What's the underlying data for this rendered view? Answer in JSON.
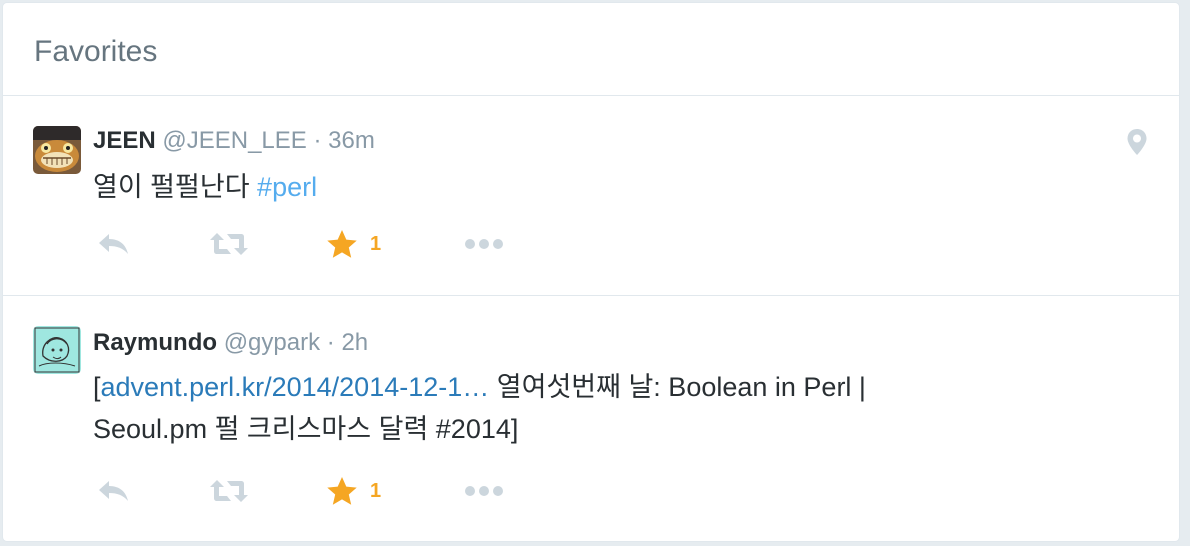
{
  "panel": {
    "title": "Favorites"
  },
  "tweets": [
    {
      "fullname": "JEEN",
      "screenname": "@JEEN_LEE",
      "separator": "·",
      "time": "36m",
      "text_main": "열이 펄펄난다 ",
      "hashtag": "#perl",
      "fav_count": "1",
      "icons": [
        "reply-icon",
        "retweet-icon",
        "favorite-icon",
        "more-icon",
        "geo-pin-icon"
      ]
    },
    {
      "fullname": "Raymundo",
      "screenname": "@gypark",
      "separator": "·",
      "time": "2h",
      "text_open": "[",
      "link": "advent.perl.kr/2014/2014-12-1…",
      "text_rest": " 열여섯번째 날: Boolean in Perl |",
      "text_line2": "Seoul.pm 펄 크리스마스 달력 #2014]",
      "fav_count": "1",
      "icons": [
        "reply-icon",
        "retweet-icon",
        "favorite-icon",
        "more-icon"
      ]
    }
  ],
  "colors": {
    "favorite": "#f5a623",
    "link": "#2b7bb9",
    "hashtag": "#55acee",
    "muted": "#8899a6"
  }
}
